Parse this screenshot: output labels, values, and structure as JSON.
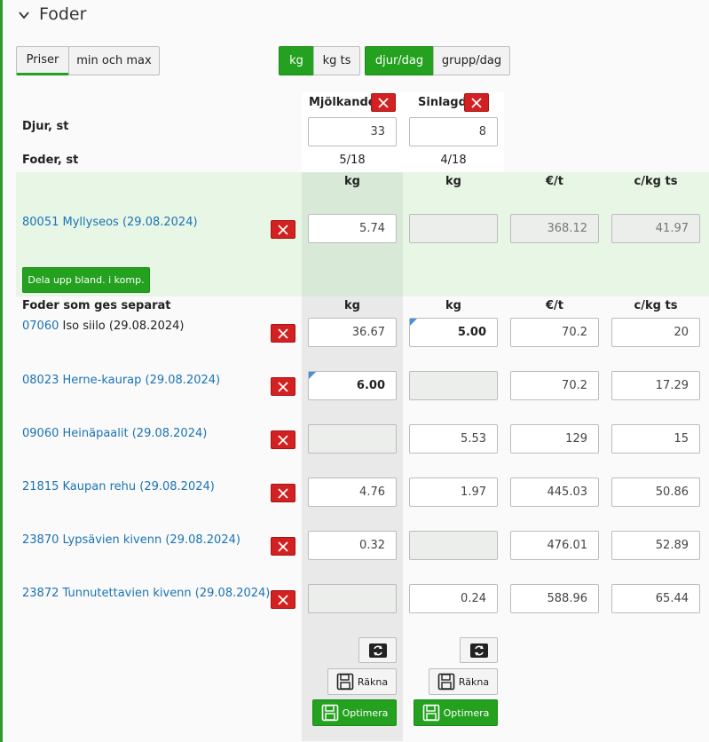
{
  "section": {
    "title": "Foder"
  },
  "toolbar": {
    "priser": "Priser",
    "min_max": "min och max",
    "kg": "kg",
    "kg_ts": "kg ts",
    "djur_dag": "djur/dag",
    "grupp_dag": "grupp/dag"
  },
  "groups": [
    {
      "name": "Mjölkande",
      "animals": "33",
      "feeds": "5/18"
    },
    {
      "name": "Sinlagd",
      "animals": "8",
      "feeds": "4/18"
    }
  ],
  "labels": {
    "djur": "Djur, st",
    "foder": "Foder, st",
    "separate": "Foder som ges separat",
    "split_button": "Dela upp bland. i komp.",
    "col_kg": "kg",
    "col_eur_t": "€/t",
    "col_c_kg_ts": "c/kg ts"
  },
  "mix": {
    "code": "80051",
    "name": "Myllyseos (29.08.2024)",
    "mjolk": "5.74",
    "sin": "",
    "eur_t": "368.12",
    "c_kg_ts": "41.97"
  },
  "feeds": [
    {
      "code": "07060",
      "name": "Iso siilo (29.08.2024)",
      "mjolk": "36.67",
      "sin": "5.00",
      "eur_t": "70.2",
      "c_kg_ts": "20"
    },
    {
      "code": "08023",
      "name": "Herne-kaurap (29.08.2024)",
      "mjolk": "6.00",
      "sin": "",
      "eur_t": "70.2",
      "c_kg_ts": "17.29"
    },
    {
      "code": "09060",
      "name": "Heinäpaalit (29.08.2024)",
      "mjolk": "",
      "sin": "5.53",
      "eur_t": "129",
      "c_kg_ts": "15"
    },
    {
      "code": "21815",
      "name": "Kaupan rehu (29.08.2024)",
      "mjolk": "4.76",
      "sin": "1.97",
      "eur_t": "445.03",
      "c_kg_ts": "50.86"
    },
    {
      "code": "23870",
      "name": "Lypsävien kivenn (29.08.2024)",
      "mjolk": "0.32",
      "sin": "",
      "eur_t": "476.01",
      "c_kg_ts": "52.89"
    },
    {
      "code": "23872",
      "name": "Tunnutettavien kivenn (29.08.2024)",
      "mjolk": "",
      "sin": "0.24",
      "eur_t": "588.96",
      "c_kg_ts": "65.44"
    }
  ],
  "actions": {
    "rakna": "Räkna",
    "optimera": "Optimera"
  },
  "colors": {
    "accent_green": "#23a11f",
    "delete_red": "#d32020",
    "link_blue": "#1a73b5",
    "mix_band": "#e8f6e6"
  }
}
